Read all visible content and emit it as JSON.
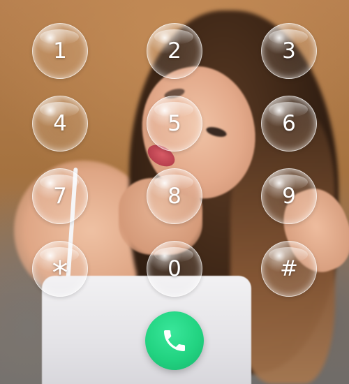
{
  "dialpad": {
    "keys": [
      {
        "label": "1"
      },
      {
        "label": "2"
      },
      {
        "label": "3"
      },
      {
        "label": "4"
      },
      {
        "label": "5"
      },
      {
        "label": "6"
      },
      {
        "label": "7"
      },
      {
        "label": "8"
      },
      {
        "label": "9"
      },
      {
        "label": "*"
      },
      {
        "label": "0"
      },
      {
        "label": "#"
      }
    ]
  },
  "call_button": {
    "icon": "phone-icon",
    "color": "#22d381"
  },
  "theme": {
    "key_text_color": "#ffffff"
  }
}
